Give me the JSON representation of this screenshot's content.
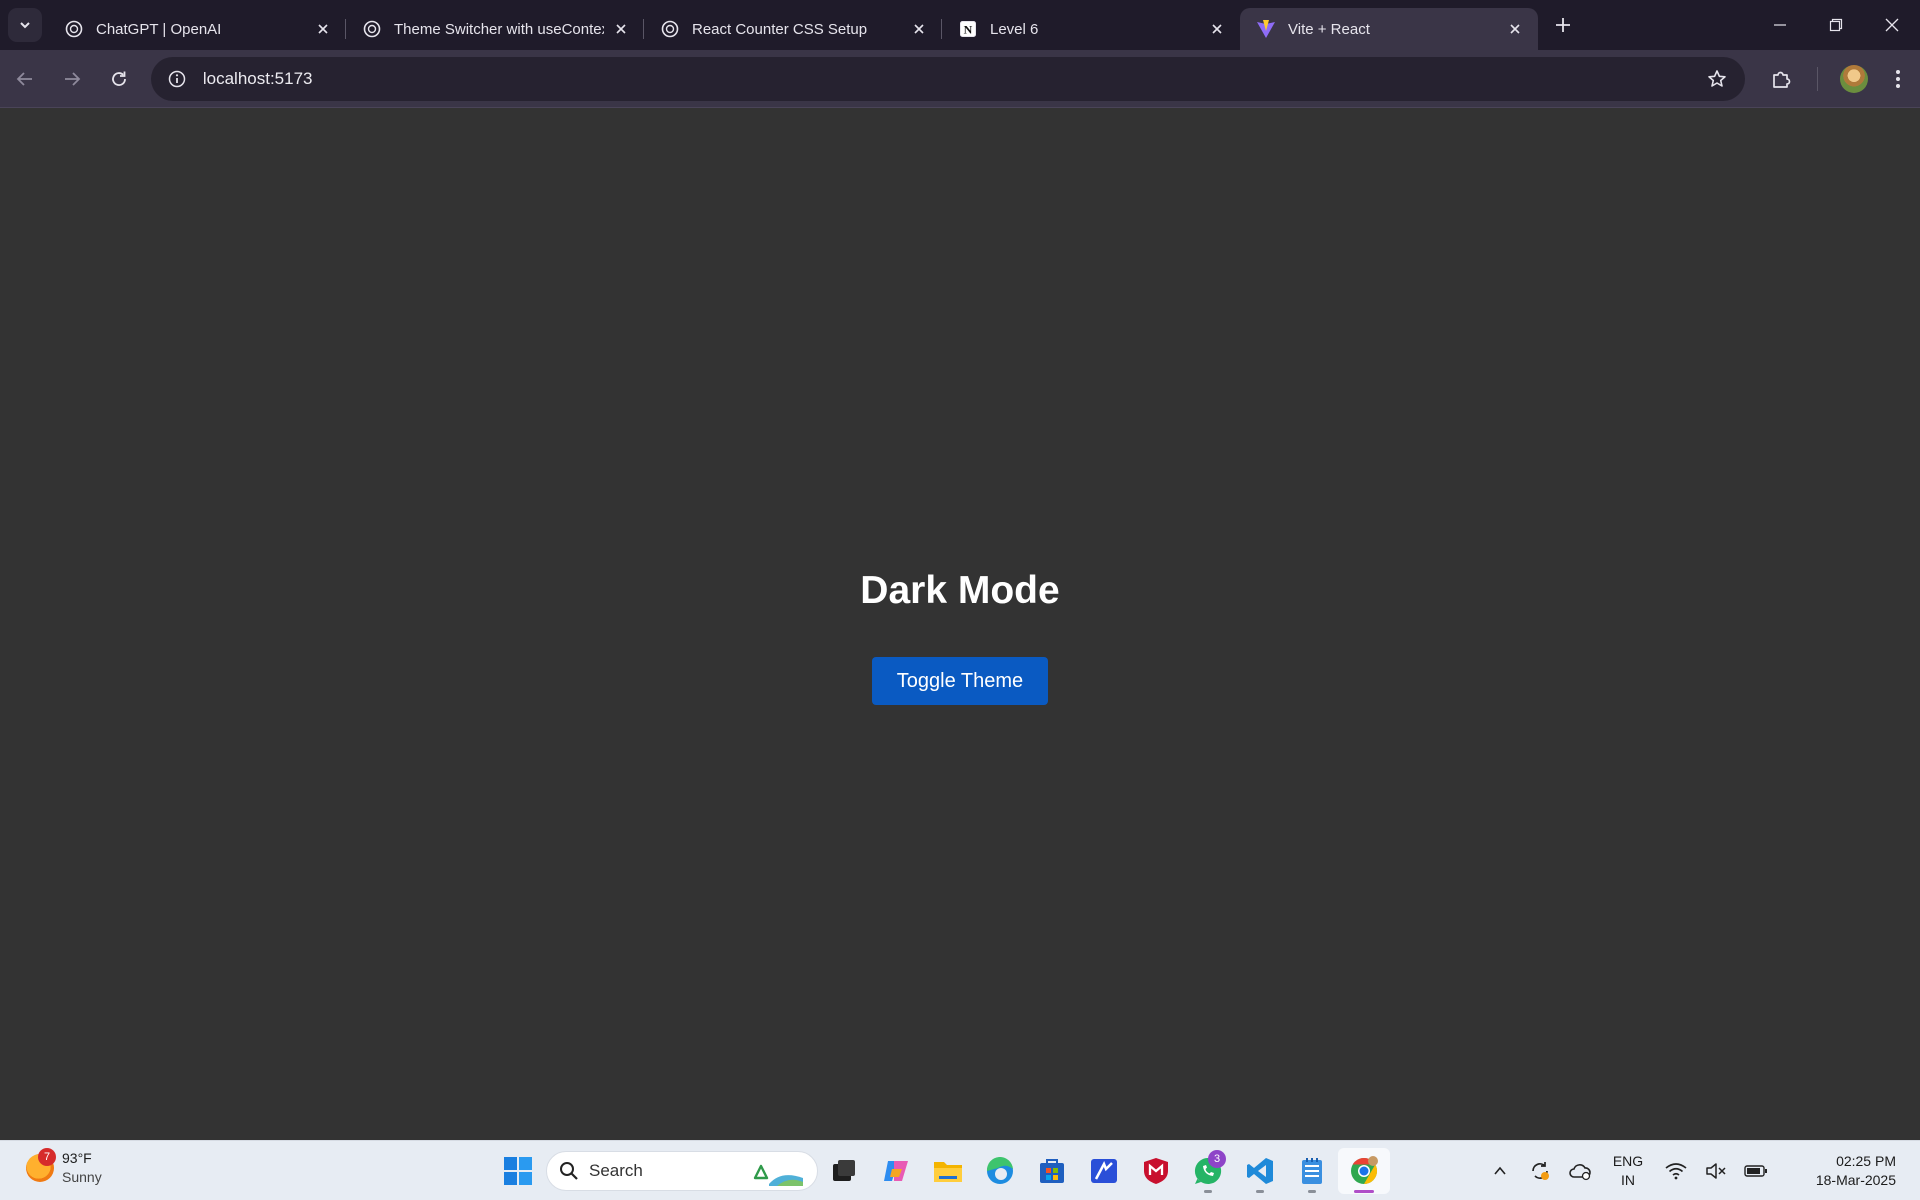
{
  "browser": {
    "tabs": [
      {
        "title": "ChatGPT | OpenAI",
        "favicon": "openai-icon"
      },
      {
        "title": "Theme Switcher with useContext",
        "favicon": "openai-icon"
      },
      {
        "title": "React Counter CSS Setup",
        "favicon": "openai-icon"
      },
      {
        "title": "Level 6",
        "favicon": "notion-icon"
      },
      {
        "title": "Vite + React",
        "favicon": "vite-icon",
        "active": true
      }
    ],
    "url": "localhost:5173"
  },
  "page": {
    "heading": "Dark Mode",
    "toggle_button": "Toggle Theme",
    "background": "#333333",
    "button_color": "#0a5ac2"
  },
  "taskbar": {
    "weather": {
      "badge": "7",
      "temperature": "93°F",
      "condition": "Sunny"
    },
    "search_placeholder": "Search",
    "whatsapp_badge": "3",
    "language": {
      "line1": "ENG",
      "line2": "IN"
    },
    "clock": {
      "time": "02:25 PM",
      "date": "18-Mar-2025"
    }
  }
}
